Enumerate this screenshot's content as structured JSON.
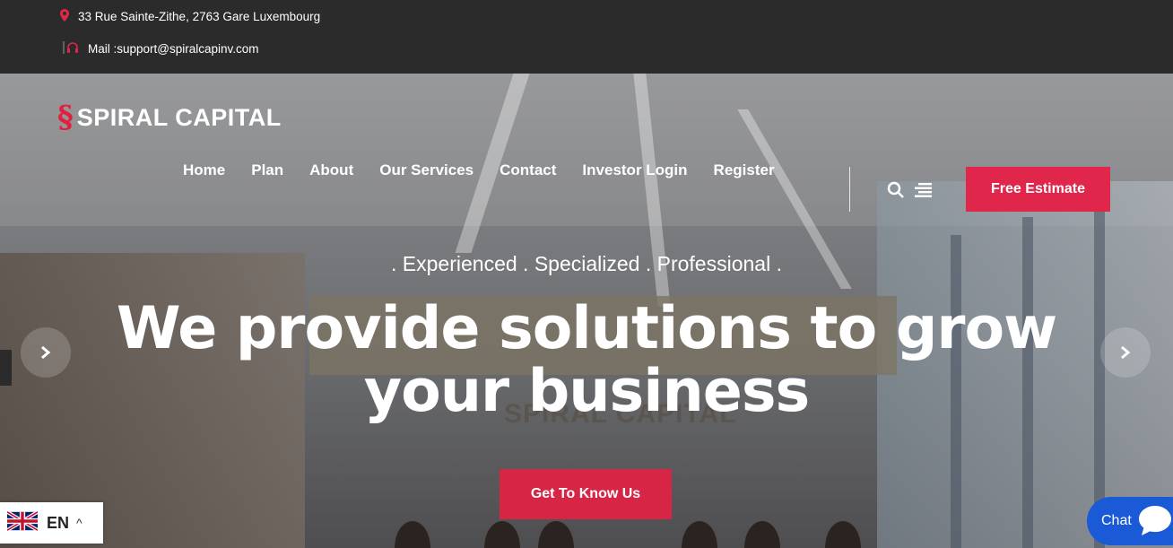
{
  "topbar": {
    "address": "33 Rue Sainte-Zithe, 2763 Gare Luxembourg",
    "mail": "Mail :support@spiralcapinv.com",
    "address_icon": "map-pin-icon",
    "mail_icon": "headset-icon"
  },
  "header": {
    "logo_text": "SPIRAL CAPITAL",
    "nav": [
      "Home",
      "Plan",
      "About",
      "Our Services",
      "Contact",
      "Investor Login",
      "Register"
    ],
    "estimate_button": "Free Estimate"
  },
  "hero": {
    "tagline": ". Experienced . Specialized . Professional .",
    "headline_line1": "We provide solutions to grow",
    "headline_line2": "your business",
    "cta": "Get To Know Us",
    "background_sign": "SPIRAL CAPITAL"
  },
  "language": {
    "code": "EN"
  },
  "chat": {
    "label": "Chat"
  },
  "colors": {
    "accent": "#e0264a",
    "topbar": "#2b2b2b",
    "chat": "#1a5ad6"
  }
}
